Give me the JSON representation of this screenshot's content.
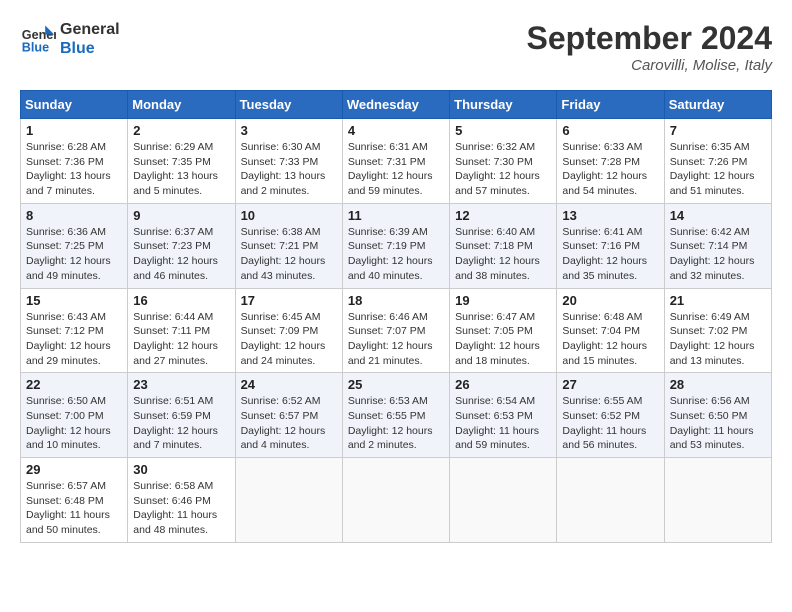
{
  "logo": {
    "line1": "General",
    "line2": "Blue"
  },
  "title": "September 2024",
  "location": "Carovilli, Molise, Italy",
  "days_header": [
    "Sunday",
    "Monday",
    "Tuesday",
    "Wednesday",
    "Thursday",
    "Friday",
    "Saturday"
  ],
  "weeks": [
    [
      {
        "day": "1",
        "info": "Sunrise: 6:28 AM\nSunset: 7:36 PM\nDaylight: 13 hours and 7 minutes."
      },
      {
        "day": "2",
        "info": "Sunrise: 6:29 AM\nSunset: 7:35 PM\nDaylight: 13 hours and 5 minutes."
      },
      {
        "day": "3",
        "info": "Sunrise: 6:30 AM\nSunset: 7:33 PM\nDaylight: 13 hours and 2 minutes."
      },
      {
        "day": "4",
        "info": "Sunrise: 6:31 AM\nSunset: 7:31 PM\nDaylight: 12 hours and 59 minutes."
      },
      {
        "day": "5",
        "info": "Sunrise: 6:32 AM\nSunset: 7:30 PM\nDaylight: 12 hours and 57 minutes."
      },
      {
        "day": "6",
        "info": "Sunrise: 6:33 AM\nSunset: 7:28 PM\nDaylight: 12 hours and 54 minutes."
      },
      {
        "day": "7",
        "info": "Sunrise: 6:35 AM\nSunset: 7:26 PM\nDaylight: 12 hours and 51 minutes."
      }
    ],
    [
      {
        "day": "8",
        "info": "Sunrise: 6:36 AM\nSunset: 7:25 PM\nDaylight: 12 hours and 49 minutes."
      },
      {
        "day": "9",
        "info": "Sunrise: 6:37 AM\nSunset: 7:23 PM\nDaylight: 12 hours and 46 minutes."
      },
      {
        "day": "10",
        "info": "Sunrise: 6:38 AM\nSunset: 7:21 PM\nDaylight: 12 hours and 43 minutes."
      },
      {
        "day": "11",
        "info": "Sunrise: 6:39 AM\nSunset: 7:19 PM\nDaylight: 12 hours and 40 minutes."
      },
      {
        "day": "12",
        "info": "Sunrise: 6:40 AM\nSunset: 7:18 PM\nDaylight: 12 hours and 38 minutes."
      },
      {
        "day": "13",
        "info": "Sunrise: 6:41 AM\nSunset: 7:16 PM\nDaylight: 12 hours and 35 minutes."
      },
      {
        "day": "14",
        "info": "Sunrise: 6:42 AM\nSunset: 7:14 PM\nDaylight: 12 hours and 32 minutes."
      }
    ],
    [
      {
        "day": "15",
        "info": "Sunrise: 6:43 AM\nSunset: 7:12 PM\nDaylight: 12 hours and 29 minutes."
      },
      {
        "day": "16",
        "info": "Sunrise: 6:44 AM\nSunset: 7:11 PM\nDaylight: 12 hours and 27 minutes."
      },
      {
        "day": "17",
        "info": "Sunrise: 6:45 AM\nSunset: 7:09 PM\nDaylight: 12 hours and 24 minutes."
      },
      {
        "day": "18",
        "info": "Sunrise: 6:46 AM\nSunset: 7:07 PM\nDaylight: 12 hours and 21 minutes."
      },
      {
        "day": "19",
        "info": "Sunrise: 6:47 AM\nSunset: 7:05 PM\nDaylight: 12 hours and 18 minutes."
      },
      {
        "day": "20",
        "info": "Sunrise: 6:48 AM\nSunset: 7:04 PM\nDaylight: 12 hours and 15 minutes."
      },
      {
        "day": "21",
        "info": "Sunrise: 6:49 AM\nSunset: 7:02 PM\nDaylight: 12 hours and 13 minutes."
      }
    ],
    [
      {
        "day": "22",
        "info": "Sunrise: 6:50 AM\nSunset: 7:00 PM\nDaylight: 12 hours and 10 minutes."
      },
      {
        "day": "23",
        "info": "Sunrise: 6:51 AM\nSunset: 6:59 PM\nDaylight: 12 hours and 7 minutes."
      },
      {
        "day": "24",
        "info": "Sunrise: 6:52 AM\nSunset: 6:57 PM\nDaylight: 12 hours and 4 minutes."
      },
      {
        "day": "25",
        "info": "Sunrise: 6:53 AM\nSunset: 6:55 PM\nDaylight: 12 hours and 2 minutes."
      },
      {
        "day": "26",
        "info": "Sunrise: 6:54 AM\nSunset: 6:53 PM\nDaylight: 11 hours and 59 minutes."
      },
      {
        "day": "27",
        "info": "Sunrise: 6:55 AM\nSunset: 6:52 PM\nDaylight: 11 hours and 56 minutes."
      },
      {
        "day": "28",
        "info": "Sunrise: 6:56 AM\nSunset: 6:50 PM\nDaylight: 11 hours and 53 minutes."
      }
    ],
    [
      {
        "day": "29",
        "info": "Sunrise: 6:57 AM\nSunset: 6:48 PM\nDaylight: 11 hours and 50 minutes."
      },
      {
        "day": "30",
        "info": "Sunrise: 6:58 AM\nSunset: 6:46 PM\nDaylight: 11 hours and 48 minutes."
      },
      null,
      null,
      null,
      null,
      null
    ]
  ]
}
